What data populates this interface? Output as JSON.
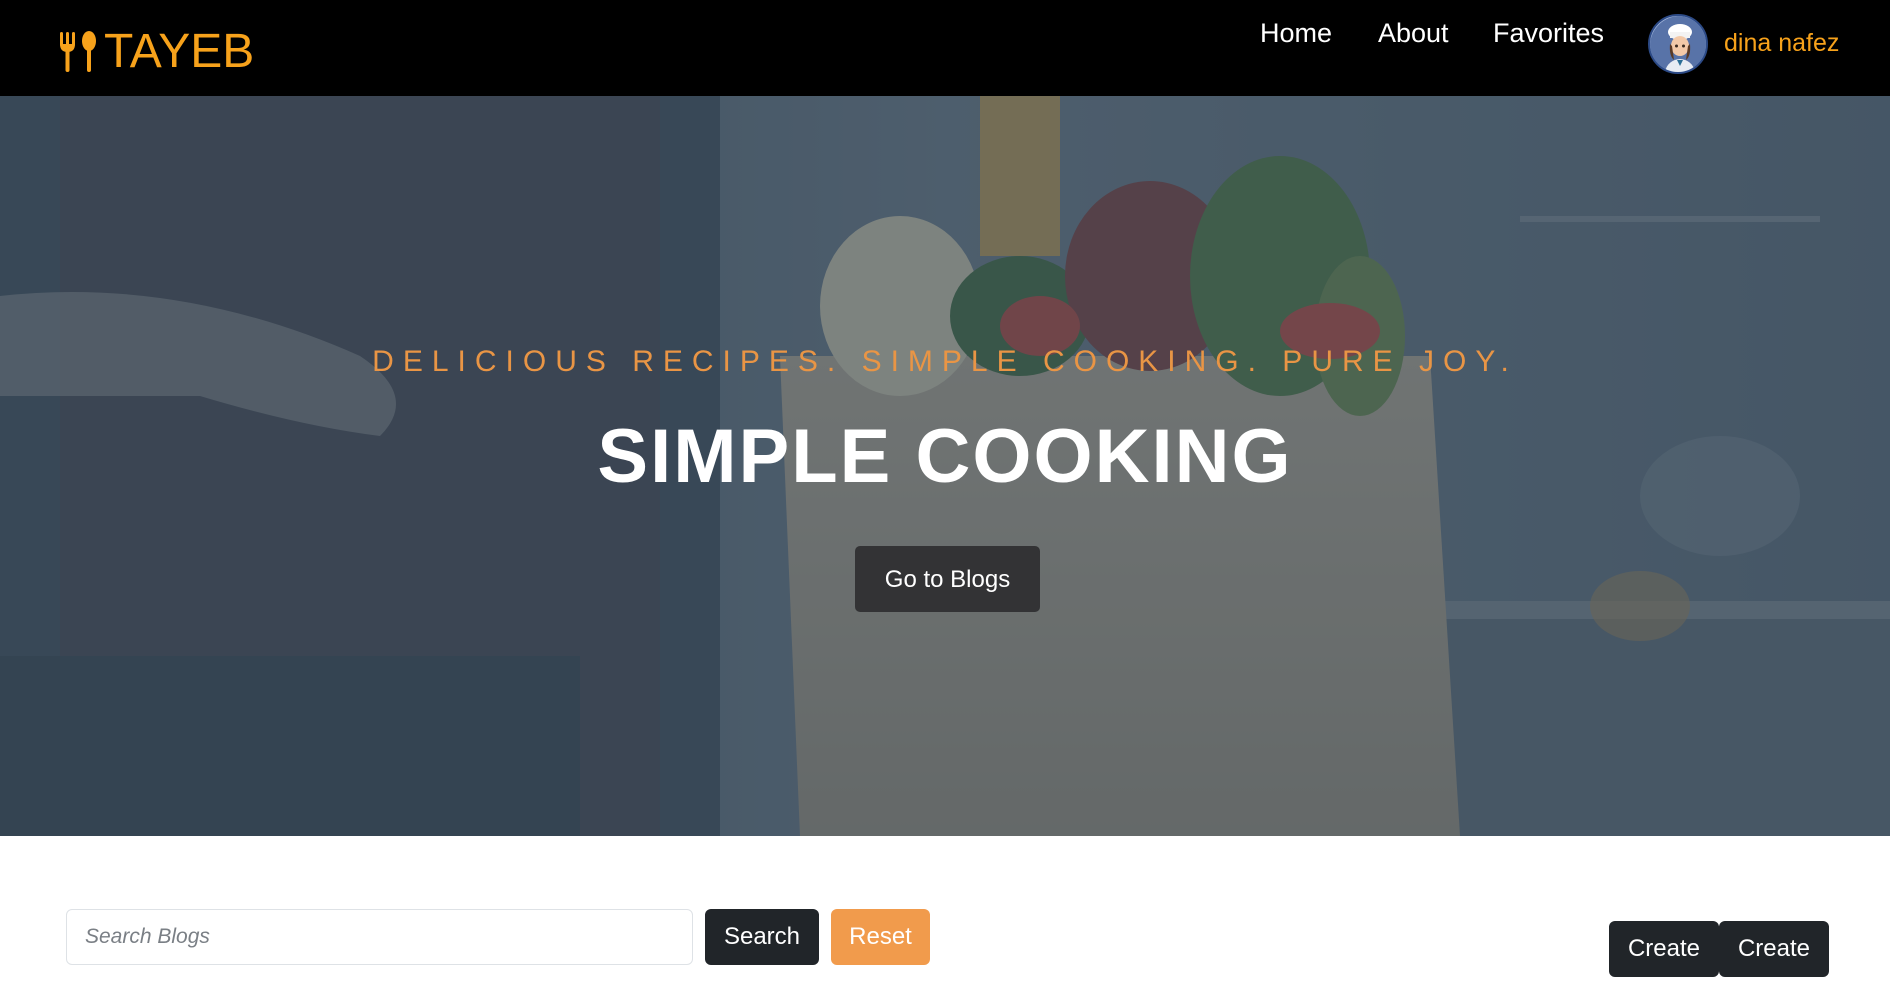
{
  "brand": {
    "logo_text": "TAYEB",
    "logo_icon": "fork-spoon-icon",
    "accent_color": "#f7a21b"
  },
  "nav": {
    "items": [
      {
        "label": "Home"
      },
      {
        "label": "About"
      },
      {
        "label": "Favorites"
      }
    ],
    "user_name": "dina nafez",
    "avatar_icon": "user-avatar"
  },
  "hero": {
    "tagline": "DELICIOUS RECIPES. SIMPLE COOKING. PURE JOY.",
    "title": "SIMPLE COOKING",
    "button_label": "Go to Blogs",
    "tagline_color": "#e99545"
  },
  "controls": {
    "search_placeholder": "Search Blogs",
    "search_value": "",
    "search_label": "Search",
    "reset_label": "Reset",
    "create_labels": [
      "Create",
      "Create"
    ],
    "reset_color": "#f19b4c",
    "dark_button_color": "#212529"
  }
}
